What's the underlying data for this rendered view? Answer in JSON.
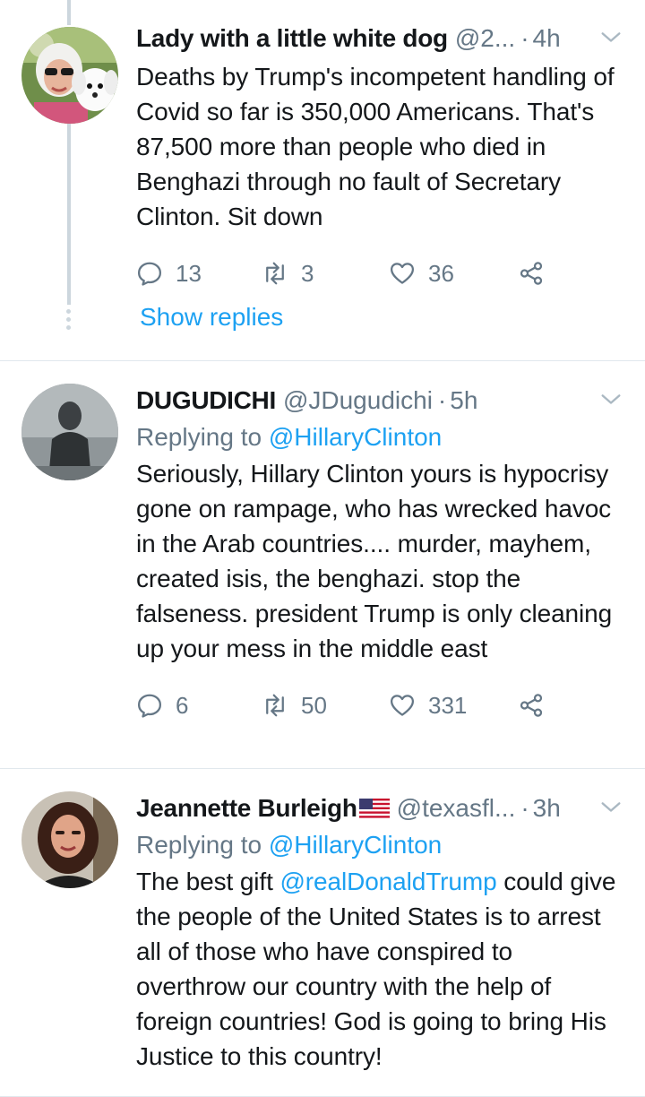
{
  "tweets": [
    {
      "name": "Lady with a little white dog",
      "handle": "@2...",
      "dot": "·",
      "time": "4h",
      "text": "Deaths by Trump's incompetent handling of Covid so far is 350,000 Americans. That's 87,500 more than people who died in Benghazi through no fault of Secretary Clinton. Sit down",
      "replies": "13",
      "retweets": "3",
      "likes": "36",
      "show_replies": "Show replies"
    },
    {
      "name": "DUGUDICHI",
      "handle": "@JDugudichi",
      "dot": "·",
      "time": "5h",
      "replying_prefix": "Replying to",
      "replying_to": "@HillaryClinton",
      "text": "Seriously, Hillary Clinton yours is hypocrisy gone on rampage, who has wrecked havoc in the Arab countries.... murder, mayhem, created isis, the benghazi. stop the falseness. president Trump is only cleaning up your mess in the middle east",
      "replies": "6",
      "retweets": "50",
      "likes": "331"
    },
    {
      "name": "Jeannette Burleigh",
      "handle": "@texasfl...",
      "dot": "·",
      "time": "3h",
      "replying_prefix": "Replying to",
      "replying_to": "@HillaryClinton",
      "text_before": "The best gift ",
      "text_link": "@realDonaldTrump",
      "text_after": " could give the people of the United States is to arrest all of those who have conspired to overthrow our country with the help of foreign countries!  God is going to bring His Justice to this country!"
    }
  ],
  "icons": {
    "reply": "reply-icon",
    "retweet": "retweet-icon",
    "like": "heart-icon",
    "share": "share-icon",
    "caret": "chevron-down-icon",
    "flag": "us-flag-icon"
  },
  "colors": {
    "link": "#1da1f2",
    "secondary": "#657786",
    "text": "#14171a",
    "divider": "#e1e8ed",
    "thread": "#ccd6dd"
  }
}
